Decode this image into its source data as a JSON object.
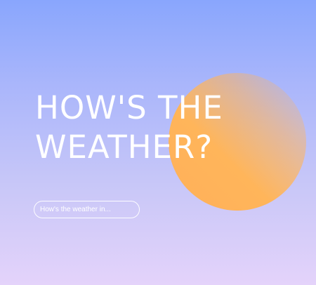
{
  "hero": {
    "title_line1": "HOW'S THE",
    "title_line2": "WEATHER?"
  },
  "search": {
    "placeholder": "How's the weather in...",
    "value": ""
  },
  "colors": {
    "background_top": "#89a6fd",
    "background_bottom": "#e4d3fa",
    "sun": "#ffb55a",
    "text": "#ffffff"
  },
  "icons": {
    "sun": "sun-icon"
  }
}
